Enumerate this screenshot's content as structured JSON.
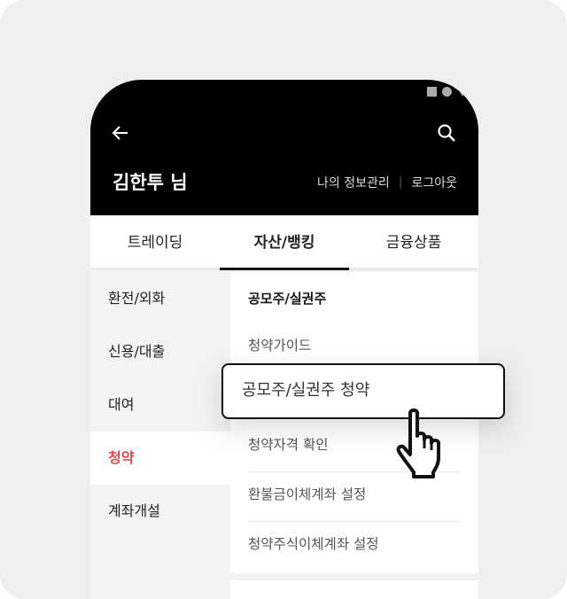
{
  "header": {
    "user_name": "김한투 님",
    "my_info": "나의 정보관리",
    "logout": "로그아웃"
  },
  "tabs": [
    {
      "label": "트레이딩"
    },
    {
      "label": "자산/뱅킹"
    },
    {
      "label": "금융상품"
    }
  ],
  "sidebar": {
    "items": [
      {
        "label": "환전/외화"
      },
      {
        "label": "신용/대출"
      },
      {
        "label": "대여"
      },
      {
        "label": "청약"
      },
      {
        "label": "계좌개설"
      }
    ]
  },
  "panel": {
    "title": "공모주/실권주",
    "items": [
      {
        "label": "청약가이드"
      },
      {
        "label": "공모주/실권주 청약"
      },
      {
        "label": "청약자격 확인"
      },
      {
        "label": "환불금이체계좌 설정"
      },
      {
        "label": "청약주식이체계좌 설정"
      }
    ]
  },
  "colors": {
    "accent": "#e8474c",
    "header_bg": "#000000"
  }
}
